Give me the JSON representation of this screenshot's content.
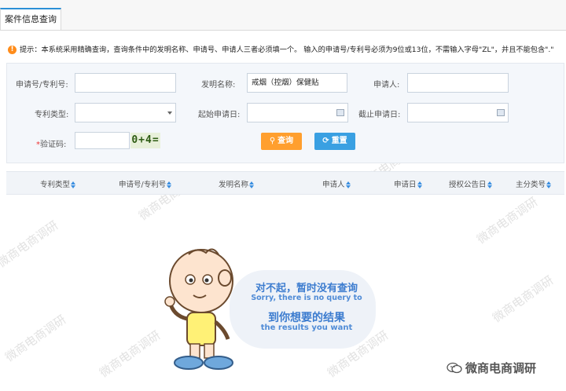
{
  "tab": {
    "label": "案件信息查询"
  },
  "notice": {
    "text": "提示：本系统采用精确查询，查询条件中的发明名称、申请号、申请人三者必须填一个。 输入的申请号/专利号必须为9位或13位，不需输入字母\"ZL\"，并且不能包含\".\""
  },
  "form": {
    "app_no_label": "申请号/专利号:",
    "app_no_value": "",
    "title_label": "发明名称:",
    "title_value": "戒烟（控烟）保健贴",
    "applicant_label": "申请人:",
    "applicant_value": "",
    "type_label": "专利类型:",
    "type_value": "",
    "start_date_label": "起始申请日:",
    "start_date_value": "",
    "end_date_label": "截止申请日:",
    "end_date_value": "",
    "captcha_label": "验证码:",
    "captcha_required": "*",
    "captcha_value": "",
    "captcha_image_text": "0+4=",
    "query_button": "查询",
    "reset_button": "重置"
  },
  "table": {
    "columns": [
      "专利类型",
      "申请号/专利号",
      "发明名称",
      "申请人",
      "申请日",
      "授权公告日",
      "主分类号"
    ]
  },
  "empty": {
    "line1": "对不起，暂时没有查询",
    "line2": "Sorry, there is no query to",
    "line3": "到你想要的结果",
    "line4": "the results you want"
  },
  "watermark": {
    "text": "微商电商调研"
  },
  "brand": {
    "text": "微商电商调研",
    "icon": "wechat-icon"
  },
  "colors": {
    "accent": "#2b8fd6",
    "query": "#ff9f2e",
    "reset": "#3aa0e2",
    "warn": "#ff8c1a"
  }
}
